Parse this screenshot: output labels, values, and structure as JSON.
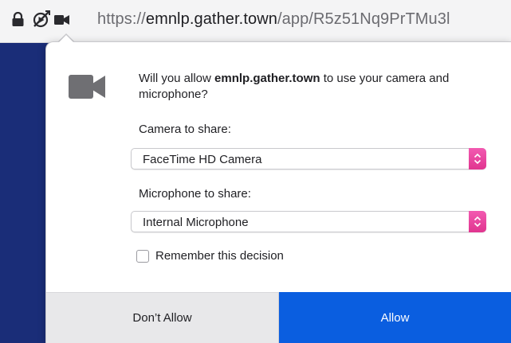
{
  "address_bar": {
    "url_prefix": "https://",
    "url_host": "emnlp.gather.town",
    "url_path": "/app/R5z51Nq9PrTMu3l",
    "icons": [
      "lock-icon",
      "autoplay-blocked-icon",
      "camera-icon"
    ]
  },
  "dialog": {
    "prompt_prefix": "Will you allow ",
    "prompt_host": "emnlp.gather.town",
    "prompt_suffix": " to use your camera and microphone?",
    "camera_label": "Camera to share:",
    "camera_selected": "FaceTime HD Camera",
    "microphone_label": "Microphone to share:",
    "microphone_selected": "Internal Microphone",
    "remember_label": "Remember this decision",
    "remember_checked": false,
    "deny_label": "Don’t Allow",
    "allow_label": "Allow"
  },
  "colors": {
    "allow_button": "#0a5ee0",
    "stepper": "#e8449e",
    "page_background": "#1b2f7a"
  }
}
